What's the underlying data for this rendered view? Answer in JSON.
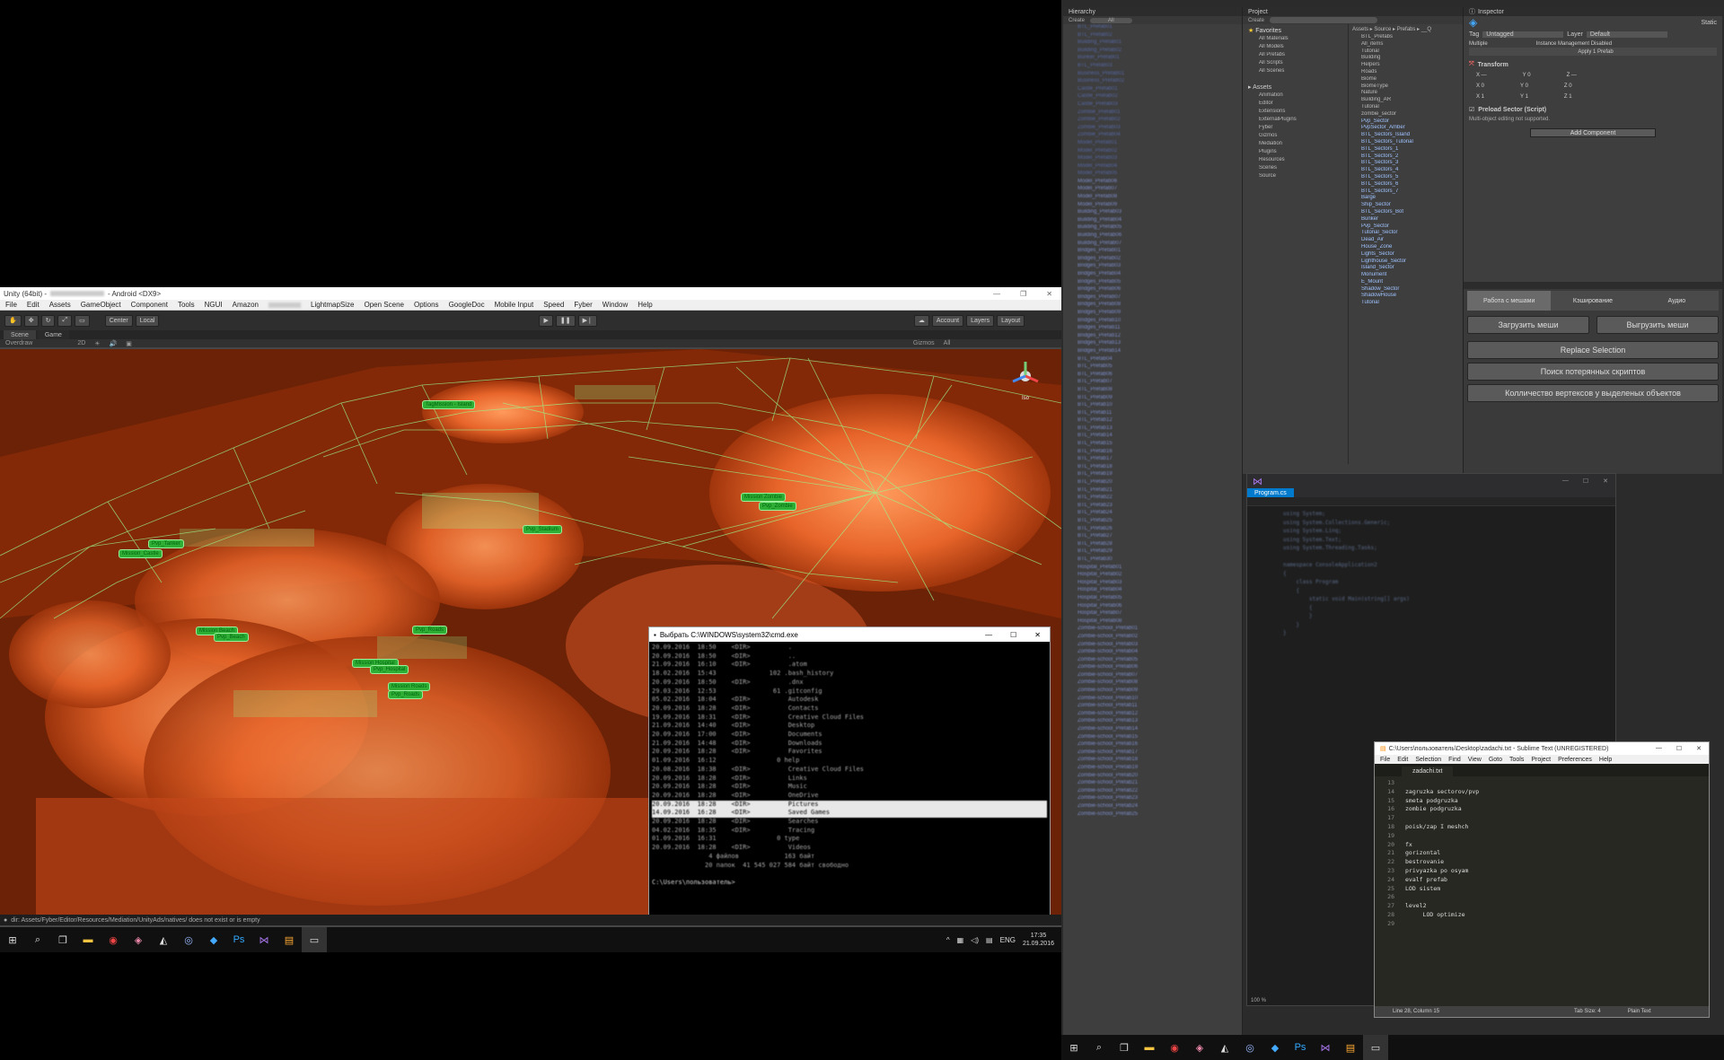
{
  "unity": {
    "title": "Unity (64bit) - ",
    "title_suffix": " - Android <DX9>",
    "menu": [
      "File",
      "Edit",
      "Assets",
      "GameObject",
      "Component",
      "Tools",
      "NGUI",
      "Amazon",
      "",
      "LightmapSize",
      "Open Scene",
      "Options",
      "GoogleDoc",
      "Mobile Input",
      "Speed",
      "Fyber",
      "Window",
      "Help"
    ],
    "toolbar": {
      "center": "Center",
      "local": "Local",
      "account": "Account",
      "layers": "Layers",
      "layout": "Layout"
    },
    "tabs": {
      "scene": "Scene",
      "game": "Game"
    },
    "scene_bar": {
      "shading": "Overdraw",
      "mode2d": "2D",
      "gizmos": "Gizmos",
      "search": "All"
    },
    "gizmo_label": "Iso",
    "status": "dir: Assets/Fyber/Editor/Resources/Mediation/UnityAds/natives/ does not exist or is empty",
    "map_labels": [
      "TagMission - Island",
      "Mission Zombie",
      "Pvp_Zombie",
      "Pvp_Tanker",
      "Mission_Castle",
      "Pvp_Stadium",
      "Mission Beach",
      "Pvp_Beach",
      "Pvp_Roads",
      "Mission Hospital",
      "Pvp_Hospital",
      "Mission Roads",
      "Pvp_Roads"
    ]
  },
  "cmd": {
    "title": "Выбрать C:\\WINDOWS\\system32\\cmd.exe",
    "lines": [
      "20.09.2016  18:50    <DIR>          .",
      "20.09.2016  18:50    <DIR>          ..",
      "21.09.2016  16:10    <DIR>          .atom",
      "18.02.2016  15:43              102 .bash_history",
      "20.09.2016  18:50    <DIR>          .dnx",
      "29.03.2016  12:53               61 .gitconfig",
      "05.02.2016  18:04    <DIR>          Autodesk",
      "20.09.2016  18:28    <DIR>          Contacts",
      "19.09.2016  18:31    <DIR>          Creative Cloud Files",
      "21.09.2016  14:40    <DIR>          Desktop",
      "20.09.2016  17:00    <DIR>          Documents",
      "21.09.2016  14:48    <DIR>          Downloads",
      "20.09.2016  18:28    <DIR>          Favorites",
      "01.09.2016  16:12                0 help",
      "20.08.2016  18:38    <DIR>          Creative Cloud Files",
      "20.09.2016  18:28    <DIR>          Links",
      "20.09.2016  18:28    <DIR>          Music",
      "20.09.2016  18:28    <DIR>          OneDrive",
      "20.09.2016  18:28    <DIR>          Pictures",
      "14.09.2016  16:28    <DIR>          Saved Games",
      "20.09.2016  18:28    <DIR>          Searches",
      "04.02.2016  18:35    <DIR>          Tracing",
      "01.09.2016  16:31                0 type",
      "20.09.2016  18:28    <DIR>          Videos",
      "               4 файлов            163 байт",
      "              20 папок  41 545 027 584 байт свободно",
      "",
      "C:\\Users\\пользователь>"
    ]
  },
  "hierarchy": {
    "title": "Hierarchy",
    "create": "Create",
    "search": "All",
    "rows": [
      "BTL_Prefab01",
      "BTL_Prefab02",
      "Building_Prefab01",
      "Building_Prefab02",
      "Bunker_Prefab01",
      "BTL_Prefab03",
      "Business_Prefab01",
      "Business_Prefab02",
      "Castle_Prefab01",
      "Castle_Prefab02",
      "Castle_Prefab03",
      "Zombie_Prefab01",
      "Zombie_Prefab02",
      "Zombie_Prefab03",
      "Zombie_Prefab04",
      "Model_Prefab01",
      "Model_Prefab02",
      "Model_Prefab03",
      "Model_Prefab04",
      "Model_Prefab05",
      "Model_Prefab06",
      "Model_Prefab07",
      "Model_Prefab08",
      "Model_Prefab09",
      "Building_Prefab03",
      "Building_Prefab04",
      "Building_Prefab05",
      "Building_Prefab06",
      "Building_Prefab07",
      "Bridges_Prefab01",
      "Bridges_Prefab02",
      "Bridges_Prefab03",
      "Bridges_Prefab04",
      "Bridges_Prefab05",
      "Bridges_Prefab06",
      "Bridges_Prefab07",
      "Bridges_Prefab08",
      "Bridges_Prefab09",
      "Bridges_Prefab10",
      "Bridges_Prefab11",
      "Bridges_Prefab12",
      "Bridges_Prefab13",
      "Bridges_Prefab14",
      "BTL_Prefab04",
      "BTL_Prefab05",
      "BTL_Prefab06",
      "BTL_Prefab07",
      "BTL_Prefab08",
      "BTL_Prefab09",
      "BTL_Prefab10",
      "BTL_Prefab11",
      "BTL_Prefab12",
      "BTL_Prefab13",
      "BTL_Prefab14",
      "BTL_Prefab15",
      "BTL_Prefab16",
      "BTL_Prefab17",
      "BTL_Prefab18",
      "BTL_Prefab19",
      "BTL_Prefab20",
      "BTL_Prefab21",
      "BTL_Prefab22",
      "BTL_Prefab23",
      "BTL_Prefab24",
      "BTL_Prefab25",
      "BTL_Prefab26",
      "BTL_Prefab27",
      "BTL_Prefab28",
      "BTL_Prefab29",
      "BTL_Prefab30",
      "Hospital_Prefab01",
      "Hospital_Prefab02",
      "Hospital_Prefab03",
      "Hospital_Prefab04",
      "Hospital_Prefab05",
      "Hospital_Prefab06",
      "Hospital_Prefab07",
      "Hospital_Prefab08",
      "Zombie-school_Prefab01",
      "Zombie-school_Prefab02",
      "Zombie-school_Prefab03",
      "Zombie-school_Prefab04",
      "Zombie-school_Prefab05",
      "Zombie-school_Prefab06",
      "Zombie-school_Prefab07",
      "Zombie-school_Prefab08",
      "Zombie-school_Prefab09",
      "Zombie-school_Prefab10",
      "Zombie-school_Prefab11",
      "Zombie-school_Prefab12",
      "Zombie-school_Prefab13",
      "Zombie-school_Prefab14",
      "Zombie-school_Prefab15",
      "Zombie-school_Prefab16",
      "Zombie-school_Prefab17",
      "Zombie-school_Prefab18",
      "Zombie-school_Prefab19",
      "Zombie-school_Prefab20",
      "Zombie-school_Prefab21",
      "Zombie-school_Prefab22",
      "Zombie-school_Prefab23",
      "Zombie-school_Prefab24",
      "Zombie-school_Prefab25"
    ]
  },
  "project": {
    "title": "Project",
    "create": "Create",
    "favorites_title": "Favorites",
    "favorites": [
      "All Materials",
      "All Models",
      "All Prefabs",
      "All Scripts",
      "All Scenes"
    ],
    "assets_title": "Assets",
    "folders": [
      "Animation",
      "Editor",
      "Extensions",
      "ExternalPlugins",
      "Fyber",
      "Gizmos",
      "Mediation",
      "Plugins",
      "Resources",
      "Scenes",
      "Source"
    ],
    "breadcrumb": "Assets ▸ Source ▸ Prefabs ▸ __Q",
    "files": [
      "BTL_Prefabs",
      "All_items",
      "Tutorial",
      "Building",
      "Helpers",
      "Roads",
      "Biome",
      "BiomeType",
      "Nature",
      "Building_AR",
      "Tutorial",
      "zombie_sector",
      "Pvp_Sector",
      "PvpSector_Amber",
      "BTL_Sectors_Island",
      "BTL_Sectors_Tutorial",
      "BTL_Sectors_1",
      "BTL_Sectors_2",
      "BTL_Sectors_3",
      "BTL_Sectors_4",
      "BTL_Sectors_5",
      "BTL_Sectors_6",
      "BTL_Sectors_7",
      "Barge",
      "Ship_Sector",
      "BTL_Sectors_Bot",
      "Bunker",
      "Pvp_Sector",
      "Tutorial_Sector",
      "Dead_Air",
      "House_Zone",
      "Lights_Sector",
      "Lighthouse_Sector",
      "Island_Sector",
      "Monument",
      "E_Mount",
      "Shadow_Sector",
      "ShadowHouse",
      "Tutorial"
    ]
  },
  "inspector": {
    "title": "Inspector",
    "static": "Static",
    "tag_label": "Tag",
    "tag_value": "Untagged",
    "layer_label": "Layer",
    "layer_value": "Default",
    "multiple": "Multiple",
    "instance_note": "Instance Management Disabled",
    "apply_prefab": "Apply 1 Prefab",
    "transform": "Transform",
    "pos": {
      "x": "X —",
      "y": "Y 0",
      "z": "Z —"
    },
    "rot": {
      "x": "X 0",
      "y": "Y 0",
      "z": "Z 0"
    },
    "scale": {
      "x": "X 1",
      "y": "Y 1",
      "z": "Z 1"
    },
    "script_component": "Preload Sector (Script)",
    "script_note": "Multi-object editing not supported.",
    "add_component": "Add Component"
  },
  "tool_panel": {
    "tabs": [
      "Работа с мешами",
      "Кэширование",
      "Аудио"
    ],
    "buttons_row": [
      "Загрузить меши",
      "Выгрузить меши"
    ],
    "buttons": [
      "Replace Selection",
      "Поиск потерянных скриптов",
      "Колличество вертексов у выделеных объектов"
    ]
  },
  "vs": {
    "tab": "Program.cs",
    "zoom": "100 %",
    "code": [
      "using System;",
      "using System.Collections.Generic;",
      "using System.Linq;",
      "using System.Text;",
      "using System.Threading.Tasks;",
      "",
      "namespace ConsoleApplication2",
      "{",
      "    class Program",
      "    {",
      "        static void Main(string[] args)",
      "        {",
      "        }",
      "    }",
      "}"
    ]
  },
  "sublime": {
    "title": "C:\\Users\\пользователь\\Desktop\\zadachi.txt - Sublime Text (UNREGISTERED)",
    "menu": [
      "File",
      "Edit",
      "Selection",
      "Find",
      "View",
      "Goto",
      "Tools",
      "Project",
      "Preferences",
      "Help"
    ],
    "tab": "zadachi.txt",
    "lines": [
      {
        "n": "13",
        "t": ""
      },
      {
        "n": "14",
        "t": "zagruzka sectorov/pvp"
      },
      {
        "n": "15",
        "t": "smeta podgruzka"
      },
      {
        "n": "16",
        "t": "zombie podgruzka"
      },
      {
        "n": "17",
        "t": ""
      },
      {
        "n": "18",
        "t": "poisk/zap I meshch"
      },
      {
        "n": "19",
        "t": ""
      },
      {
        "n": "20",
        "t": "fx"
      },
      {
        "n": "21",
        "t": "gorizontal"
      },
      {
        "n": "22",
        "t": "bestrovanie"
      },
      {
        "n": "23",
        "t": "privyazka po osyam"
      },
      {
        "n": "24",
        "t": "evalf prefab"
      },
      {
        "n": "25",
        "t": "LOD sistem"
      },
      {
        "n": "26",
        "t": ""
      },
      {
        "n": "27",
        "t": "level2"
      },
      {
        "n": "28",
        "t": "     LOD optimize"
      },
      {
        "n": "29",
        "t": ""
      }
    ],
    "status_pos": "Line 28, Column 15",
    "tab_size": "Tab Size: 4",
    "syntax": "Plain Text"
  },
  "taskbar": {
    "lang": "ENG",
    "time": "17:35",
    "date": "21.09.2016"
  },
  "colors": {
    "scene_orange": "#e8652a",
    "wire_green": "#9cf58a",
    "label_green": "#2fae35",
    "unity_dark": "#3e3e3e",
    "vs_blue": "#007acc"
  }
}
